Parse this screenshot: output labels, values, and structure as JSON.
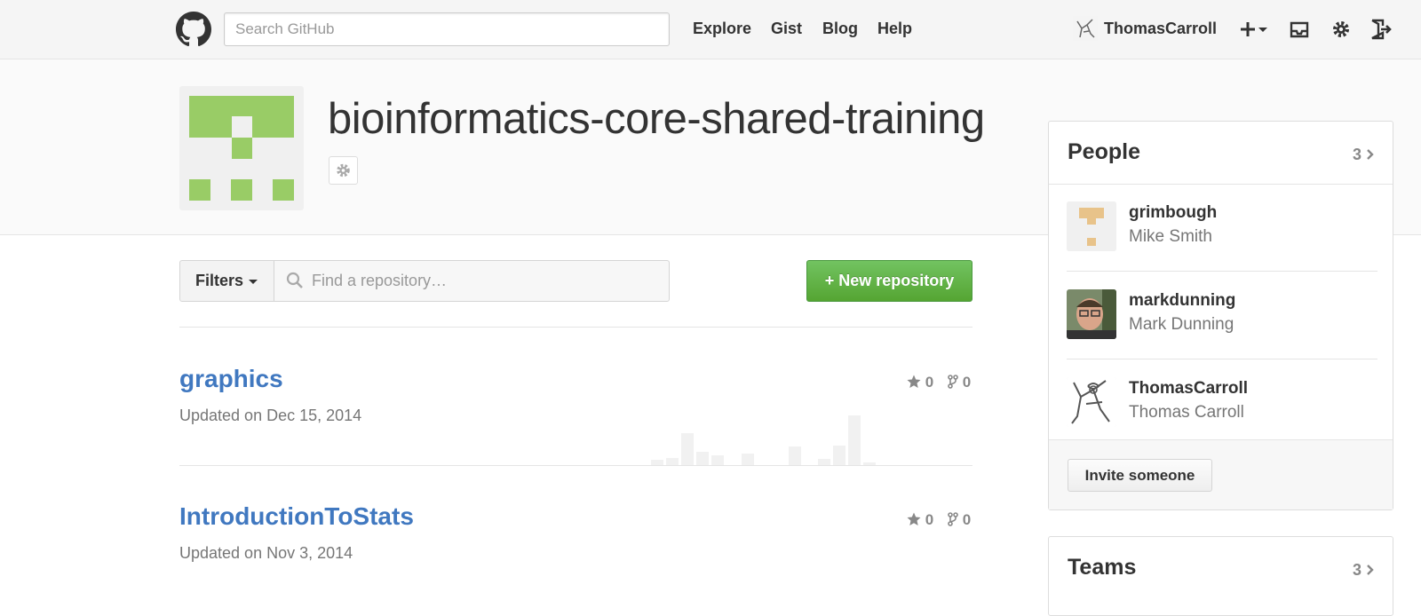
{
  "header": {
    "search_placeholder": "Search GitHub",
    "nav": [
      {
        "label": "Explore"
      },
      {
        "label": "Gist"
      },
      {
        "label": "Blog"
      },
      {
        "label": "Help"
      }
    ],
    "username": "ThomasCarroll",
    "icons": [
      "github-logo-icon",
      "plus-icon",
      "inbox-icon",
      "gear-icon",
      "sign-out-icon"
    ]
  },
  "org": {
    "name": "bioinformatics-core-shared-training",
    "avatar_color": "#99cc66"
  },
  "toolbar": {
    "filters_label": "Filters",
    "find_placeholder": "Find a repository…",
    "new_repo_label": "New repository",
    "new_repo_color": "#55a532"
  },
  "repos": [
    {
      "name": "graphics",
      "updated": "Updated on Dec 15, 2014",
      "stars": "0",
      "forks": "0"
    },
    {
      "name": "IntroductionToStats",
      "updated": "Updated on Nov 3, 2014",
      "stars": "0",
      "forks": "0"
    }
  ],
  "people": {
    "title": "People",
    "count": "3",
    "members": [
      {
        "login": "grimbough",
        "name": "Mike Smith"
      },
      {
        "login": "markdunning",
        "name": "Mark Dunning"
      },
      {
        "login": "ThomasCarroll",
        "name": "Thomas Carroll"
      }
    ],
    "invite_label": "Invite someone"
  },
  "teams": {
    "title": "Teams",
    "count": "3"
  },
  "colors": {
    "link": "#4078c0",
    "muted": "#767676"
  }
}
